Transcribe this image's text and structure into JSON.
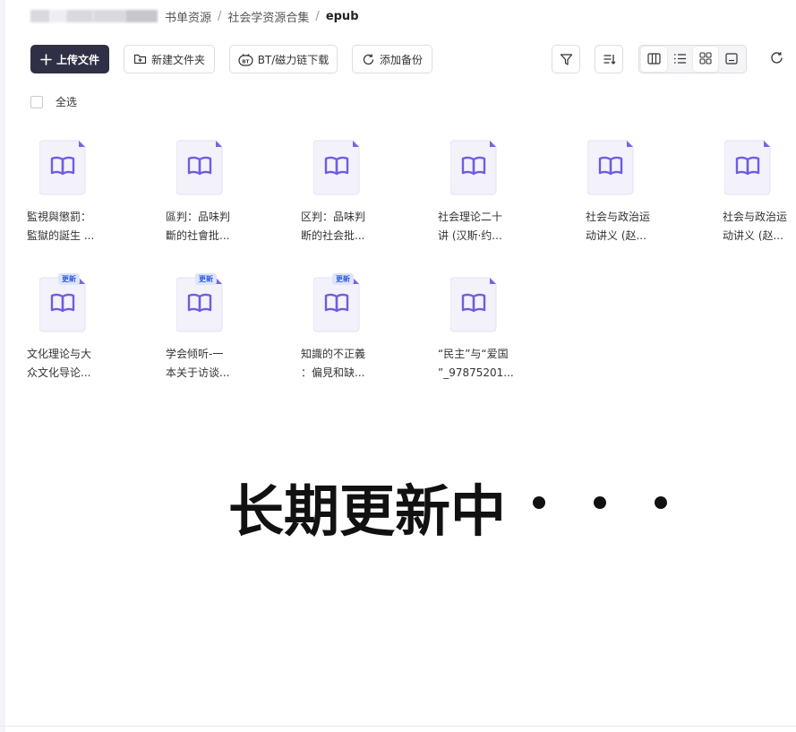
{
  "breadcrumb": {
    "items": [
      "书单资源",
      "社会学资源合集"
    ],
    "current": "epub",
    "separator": "/"
  },
  "toolbar": {
    "upload_label": "上传文件",
    "new_folder_label": "新建文件夹",
    "bt_label": "BT/磁力链下载",
    "backup_label": "添加备份"
  },
  "select_all_label": "全选",
  "files": [
    {
      "line1": "監視與懲罰：",
      "line2": "監獄的誕生 ...",
      "badge": ""
    },
    {
      "line1": "區判：品味判",
      "line2": "斷的社會批...",
      "badge": ""
    },
    {
      "line1": "区判：品味判",
      "line2": "断的社会批...",
      "badge": ""
    },
    {
      "line1": "社会理论二十",
      "line2": "讲 (汉斯·约...",
      "badge": ""
    },
    {
      "line1": "社会与政治运",
      "line2": "动讲义 (赵...",
      "badge": ""
    },
    {
      "line1": "社会与政治运",
      "line2": "动讲义 (赵...",
      "badge": ""
    },
    {
      "line1": "文化理论与大",
      "line2": "众文化导论...",
      "badge": "更新"
    },
    {
      "line1": "学会倾听-一",
      "line2": "本关于访谈...",
      "badge": "更新"
    },
    {
      "line1": "知識的不正義",
      "line2": "：偏見和缺...",
      "badge": "更新"
    },
    {
      "line1": "“民主”与“爱国",
      "line2": "”_97875201...",
      "badge": ""
    }
  ],
  "banner_text": "长期更新中",
  "colors": {
    "accent": "#2f3045",
    "icon_purple": "#6f5de0",
    "badge_bg": "#dde4fb",
    "badge_text": "#2e5be0"
  },
  "icons": [
    "plus-icon",
    "folder-add-icon",
    "bt-icon",
    "backup-icon",
    "filter-icon",
    "sort-icon",
    "column-view-icon",
    "list-view-icon",
    "grid-view-icon",
    "preview-view-icon",
    "refresh-icon",
    "book-icon"
  ]
}
